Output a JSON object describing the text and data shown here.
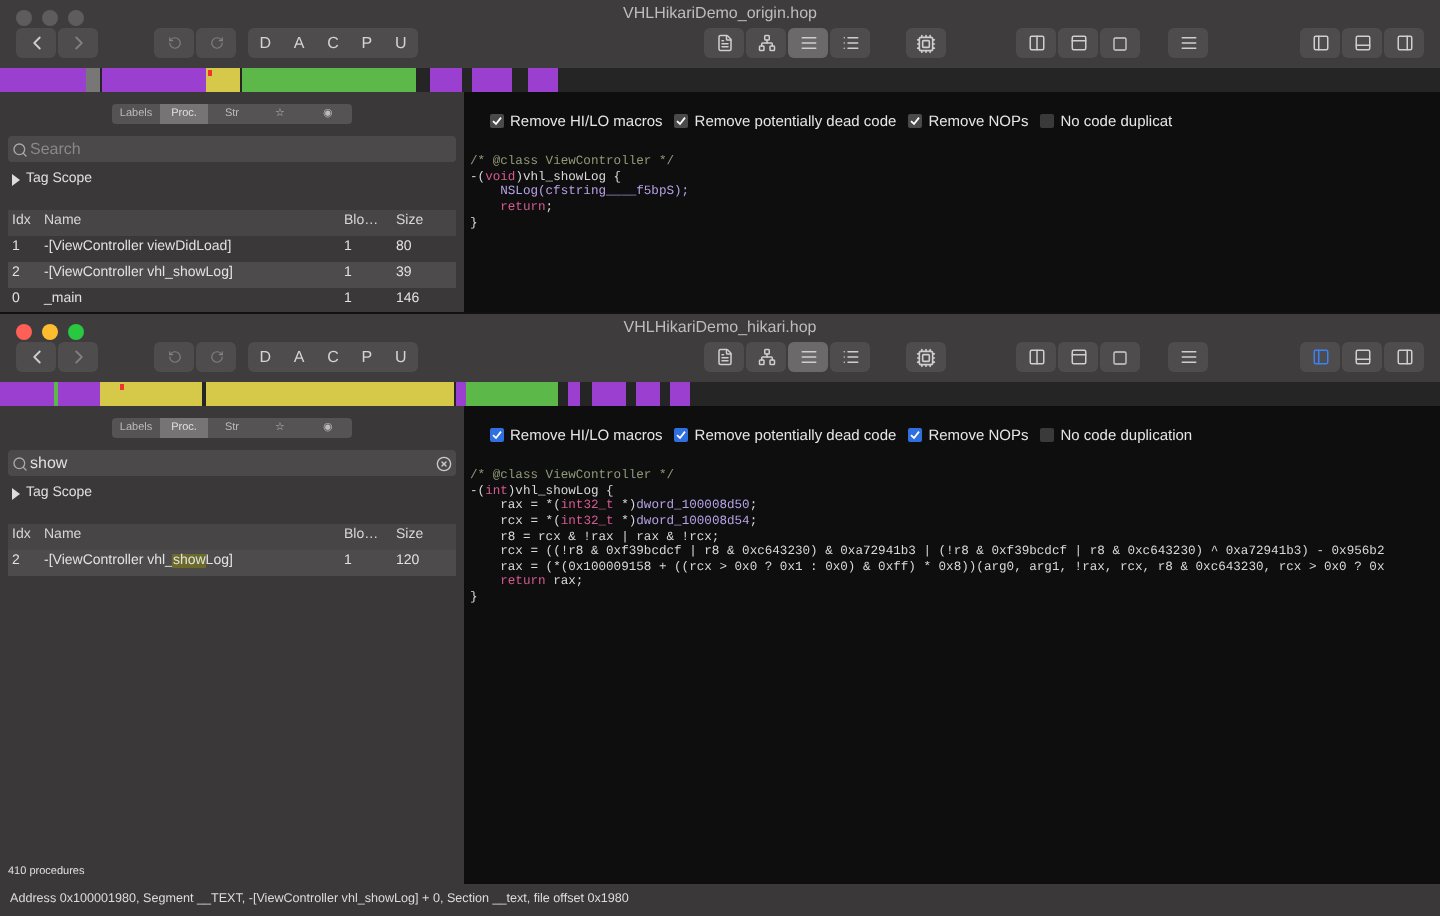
{
  "windows": [
    {
      "title": "VHLHikariDemo_origin.hop",
      "active": false,
      "mode_buttons": [
        "D",
        "A",
        "C",
        "P",
        "U"
      ],
      "sidebar_tabs": [
        {
          "label": "Labels",
          "selected": false
        },
        {
          "label": "Proc.",
          "selected": true
        },
        {
          "label": "Str",
          "selected": false
        },
        {
          "label": "☆",
          "selected": false
        },
        {
          "label": "◉",
          "selected": false
        }
      ],
      "search": {
        "placeholder": "Search"
      },
      "tag_scope": "Tag Scope",
      "table": {
        "columns": [
          "Idx",
          "Name",
          "Blo…",
          "Size"
        ],
        "rows": [
          {
            "idx": "1",
            "name": [
              {
                "text": "-[ViewController viewDidLoad]",
                "match": false
              }
            ],
            "blocks": "1",
            "size": "80",
            "selected": false
          },
          {
            "idx": "2",
            "name": [
              {
                "text": "-[ViewController vhl_showLog]",
                "match": false
              }
            ],
            "blocks": "1",
            "size": "39",
            "selected": true
          },
          {
            "idx": "0",
            "name": [
              {
                "text": "_main",
                "match": false
              }
            ],
            "blocks": "1",
            "size": "146",
            "selected": false
          }
        ]
      },
      "options": [
        {
          "label": "Remove HI/LO macros",
          "checked": true
        },
        {
          "label": "Remove potentially dead code",
          "checked": true
        },
        {
          "label": "Remove NOPs",
          "checked": true
        },
        {
          "label": "No code duplicat",
          "checked": false
        }
      ],
      "code": [
        [
          {
            "kind": "comment",
            "text": "/* @class ViewController */"
          }
        ],
        [
          {
            "kind": "plain",
            "text": "-("
          },
          {
            "kind": "keyword",
            "text": "void"
          },
          {
            "kind": "plain",
            "text": ")vhl_showLog {"
          }
        ],
        [
          {
            "kind": "indent"
          },
          {
            "kind": "symbol",
            "text": "NSLog(cfstring____f5bpS);"
          }
        ],
        [
          {
            "kind": "indent"
          },
          {
            "kind": "keyword",
            "text": "return"
          },
          {
            "kind": "plain",
            "text": ";"
          }
        ],
        [
          {
            "kind": "plain",
            "text": "}"
          }
        ]
      ]
    },
    {
      "title": "VHLHikariDemo_hikari.hop",
      "active": true,
      "mode_buttons": [
        "D",
        "A",
        "C",
        "P",
        "U"
      ],
      "sidebar_tabs": [
        {
          "label": "Labels",
          "selected": false
        },
        {
          "label": "Proc.",
          "selected": true
        },
        {
          "label": "Str",
          "selected": false
        },
        {
          "label": "☆",
          "selected": false
        },
        {
          "label": "◉",
          "selected": false
        }
      ],
      "search": {
        "value": "show"
      },
      "tag_scope": "Tag Scope",
      "table": {
        "columns": [
          "Idx",
          "Name",
          "Blo…",
          "Size"
        ],
        "rows": [
          {
            "idx": "2",
            "name": [
              {
                "text": "-[ViewController vhl_",
                "match": false
              },
              {
                "text": "show",
                "match": true
              },
              {
                "text": "Log]",
                "match": false
              }
            ],
            "blocks": "1",
            "size": "120",
            "selected": true
          }
        ]
      },
      "options": [
        {
          "label": "Remove HI/LO macros",
          "checked": true
        },
        {
          "label": "Remove potentially dead code",
          "checked": true
        },
        {
          "label": "Remove NOPs",
          "checked": true
        },
        {
          "label": "No code duplication",
          "checked": false
        }
      ],
      "code": [
        [
          {
            "kind": "comment",
            "text": "/* @class ViewController */"
          }
        ],
        [
          {
            "kind": "plain",
            "text": "-("
          },
          {
            "kind": "keyword",
            "text": "int"
          },
          {
            "kind": "plain",
            "text": ")vhl_showLog {"
          }
        ],
        [
          {
            "kind": "plain",
            "text": "    rax = *("
          },
          {
            "kind": "keyword",
            "text": "int32_t"
          },
          {
            "kind": "plain",
            "text": " *)"
          },
          {
            "kind": "symbol",
            "text": "dword_100008d50"
          },
          {
            "kind": "plain",
            "text": ";"
          }
        ],
        [
          {
            "kind": "plain",
            "text": "    rcx = *("
          },
          {
            "kind": "keyword",
            "text": "int32_t"
          },
          {
            "kind": "plain",
            "text": " *)"
          },
          {
            "kind": "symbol",
            "text": "dword_100008d54"
          },
          {
            "kind": "plain",
            "text": ";"
          }
        ],
        [
          {
            "kind": "plain",
            "text": "    r8 = rcx & !rax | rax & !rcx;"
          }
        ],
        [
          {
            "kind": "plain",
            "text": "    rcx = ((!r8 & 0xf39bcdcf | r8 & 0xc643230) & 0xa72941b3 | (!r8 & 0xf39bcdcf | r8 & 0xc643230) ^ 0xa72941b3) - 0x956b2"
          }
        ],
        [
          {
            "kind": "plain",
            "text": "    rax = (*(0x100009158 + ((rcx > 0x0 ? 0x1 : 0x0) & 0xff) * 0x8))(arg0, arg1, !rax, rcx, r8 & 0xc643230, rcx > 0x0 ? 0x"
          }
        ],
        [
          {
            "kind": "indent"
          },
          {
            "kind": "keyword",
            "text": "return"
          },
          {
            "kind": "plain",
            "text": " rax;"
          }
        ],
        [
          {
            "kind": "plain",
            "text": "}"
          }
        ]
      ],
      "procedure_count": "410 procedures"
    }
  ],
  "status_bar": "Address 0x100001980, Segment __TEXT, -[ViewController vhl_showLog] + 0, Section __text, file offset 0x1980"
}
